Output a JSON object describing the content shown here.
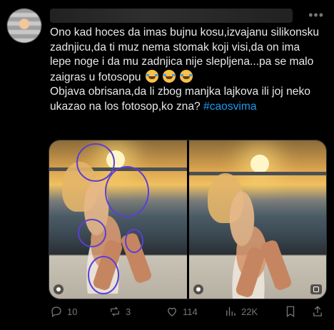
{
  "tweet": {
    "text_line1": "Ono kad hoces da imas bujnu kosu,izvajanu silikonsku zadnjicu,da ti muz nema stomak koji visi,da on ima lepe noge i da mu zadnjica nije slepljena...pa se malo zaigras u fotosopu",
    "emoji_name": "face-with-tears-of-joy",
    "text_line2": "Objava obrisana,da li zbog manjka lajkova ili joj neko ukazao na los fotosop,ko zna?",
    "hashtag": "#caosvima"
  },
  "actions": {
    "replies": "10",
    "retweets": "3",
    "likes": "114",
    "views": "22K"
  },
  "colors": {
    "background": "#000000",
    "text": "#e7e9ea",
    "muted": "#71767b",
    "link": "#1d9bf0",
    "annotation_circle": "#5b3fd6"
  }
}
